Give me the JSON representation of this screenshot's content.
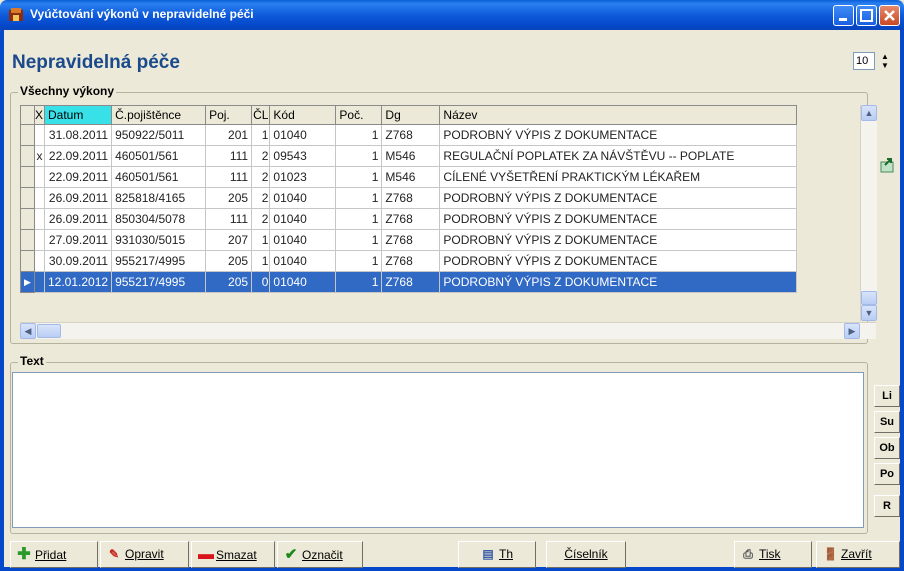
{
  "window": {
    "title": "Vyúčtování výkonů v nepravidelné péči"
  },
  "page": {
    "title": "Nepravidelná péče"
  },
  "spinner": {
    "value": "10"
  },
  "grid_group": {
    "label": "Všechny výkony"
  },
  "grid": {
    "headers": [
      "X",
      "Datum",
      "Č.pojištěnce",
      "Poj.",
      "ČL",
      "Kód",
      "Poč.",
      "Dg",
      "Název"
    ],
    "rows": [
      {
        "x": "",
        "datum": "31.08.2011",
        "cislo": "950922/5011",
        "poj": "201",
        "cl": "1",
        "kod": "01040",
        "poc": "1",
        "dg": "Z768",
        "nazev": "PODROBNÝ VÝPIS Z DOKUMENTACE"
      },
      {
        "x": "x",
        "datum": "22.09.2011",
        "cislo": "460501/561",
        "poj": "111",
        "cl": "2",
        "kod": "09543",
        "poc": "1",
        "dg": "M546",
        "nazev": "REGULAČNÍ POPLATEK ZA NÁVŠTĚVU -- POPLATE"
      },
      {
        "x": "",
        "datum": "22.09.2011",
        "cislo": "460501/561",
        "poj": "111",
        "cl": "2",
        "kod": "01023",
        "poc": "1",
        "dg": "M546",
        "nazev": "CÍLENÉ VYŠETŘENÍ PRAKTICKÝM LÉKAŘEM"
      },
      {
        "x": "",
        "datum": "26.09.2011",
        "cislo": "825818/4165",
        "poj": "205",
        "cl": "2",
        "kod": "01040",
        "poc": "1",
        "dg": "Z768",
        "nazev": "PODROBNÝ VÝPIS Z DOKUMENTACE"
      },
      {
        "x": "",
        "datum": "26.09.2011",
        "cislo": "850304/5078",
        "poj": "111",
        "cl": "2",
        "kod": "01040",
        "poc": "1",
        "dg": "Z768",
        "nazev": "PODROBNÝ VÝPIS Z DOKUMENTACE"
      },
      {
        "x": "",
        "datum": "27.09.2011",
        "cislo": "931030/5015",
        "poj": "207",
        "cl": "1",
        "kod": "01040",
        "poc": "1",
        "dg": "Z768",
        "nazev": "PODROBNÝ VÝPIS Z DOKUMENTACE"
      },
      {
        "x": "",
        "datum": "30.09.2011",
        "cislo": "955217/4995",
        "poj": "205",
        "cl": "1",
        "kod": "01040",
        "poc": "1",
        "dg": "Z768",
        "nazev": "PODROBNÝ VÝPIS Z DOKUMENTACE"
      },
      {
        "x": "",
        "datum": "12.01.2012",
        "cislo": "955217/4995",
        "poj": "205",
        "cl": "0",
        "kod": "01040",
        "poc": "1",
        "dg": "Z768",
        "nazev": "PODROBNÝ VÝPIS Z DOKUMENTACE"
      }
    ]
  },
  "text_group": {
    "label": "Text"
  },
  "format_buttons": [
    "Li",
    "Su",
    "Ob",
    "Po",
    "R"
  ],
  "toolbar": {
    "pridat": "Přidat",
    "opravit": "Opravit",
    "smazat": "Smazat",
    "oznacit": "Označit",
    "th": "Th",
    "ciselnik": "Číselník",
    "tisk": "Tisk",
    "zavrit": "Zavřít"
  },
  "colors": {
    "title_blue": "#1a4a8c",
    "selection": "#316ac5",
    "datum_header": "#38e0e8"
  }
}
